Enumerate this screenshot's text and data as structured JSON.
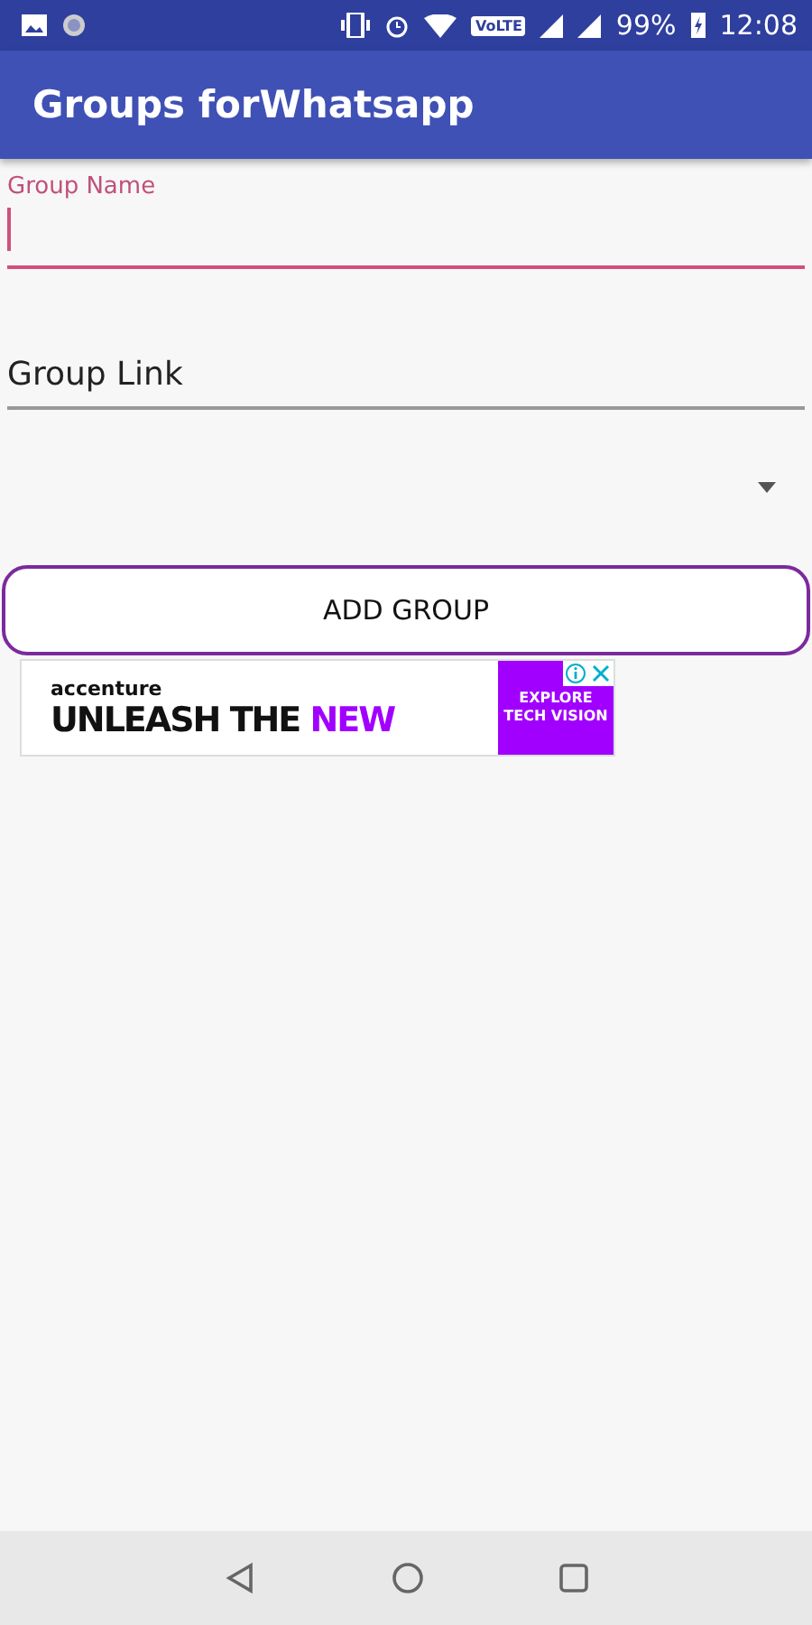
{
  "status_bar": {
    "volte": "VoLTE",
    "battery": "99%",
    "time": "12:08"
  },
  "app_bar": {
    "title": "Groups forWhatsapp"
  },
  "fields": [
    {
      "label": "Group Name",
      "focused": true
    },
    {
      "placeholder": "Group Link",
      "focused": false
    }
  ],
  "dropdown": {
    "expanded": false
  },
  "button": {
    "label": "ADD GROUP"
  },
  "ad": {
    "brand": "accenture",
    "headline": [
      {
        "text": "UNLEASH THE ",
        "highlight": false
      },
      {
        "text": "NEW",
        "highlight": true
      }
    ],
    "cta": "EXPLORE TECH VISION"
  }
}
